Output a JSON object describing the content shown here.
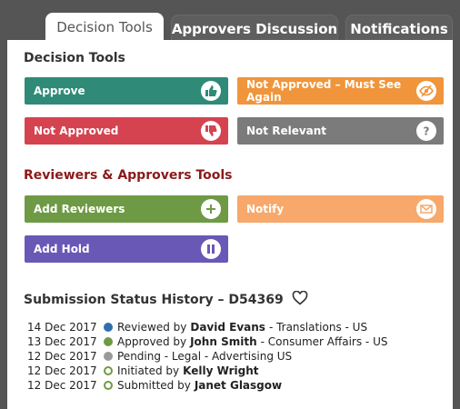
{
  "tabs": [
    {
      "label": "Decision Tools",
      "active": true
    },
    {
      "label": "Approvers Discussion",
      "active": false
    },
    {
      "label": "Notifications",
      "active": false
    }
  ],
  "decision_tools": {
    "title": "Decision Tools",
    "approve": "Approve",
    "not_approved_must_see_again": "Not Approved – Must See Again",
    "not_approved": "Not Approved",
    "not_relevant": "Not Relevant"
  },
  "reviewer_tools": {
    "title": "Reviewers & Approvers Tools",
    "add_reviewers": "Add Reviewers",
    "notify": "Notify",
    "add_hold": "Add Hold"
  },
  "history": {
    "title": "Submission Status History – D54369",
    "rows": [
      {
        "date": "14 Dec 2017",
        "action": "Reviewed by",
        "person": "David Evans",
        "detail": "- Translations - US",
        "dot_color": "#2f6fb0",
        "hollow": false
      },
      {
        "date": "13 Dec 2017",
        "action": "Approved by",
        "person": "John Smith",
        "detail": "- Consumer Affairs - US",
        "dot_color": "#6f9a45",
        "hollow": false
      },
      {
        "date": "12 Dec 2017",
        "action": "Pending - Legal - Advertising US",
        "person": "",
        "detail": "",
        "dot_color": "#9a9a9a",
        "hollow": false
      },
      {
        "date": "12 Dec 2017",
        "action": "Initiated by",
        "person": "Kelly Wright",
        "detail": "",
        "dot_color": "#6f9a45",
        "hollow": true
      },
      {
        "date": "12 Dec 2017",
        "action": "Submitted by",
        "person": "Janet Glasgow",
        "detail": "",
        "dot_color": "#6f9a45",
        "hollow": true
      }
    ]
  },
  "colors": {
    "section_title_dark": "#333333",
    "section_title_red": "#8b1a1a",
    "approve": "#2f8a78",
    "not_approved_must_see_again": "#f0953b",
    "not_approved": "#d4434f",
    "not_relevant": "#7b7b7b",
    "add_reviewers": "#6f9a45",
    "notify": "#f7a86a",
    "add_hold": "#6a58b6"
  },
  "icons": {
    "approve": "thumbs-up-icon",
    "not_approved_must_see_again": "eye-slash-icon",
    "not_approved": "thumbs-down-icon",
    "not_relevant": "question-icon",
    "add_reviewers": "plus-icon",
    "notify": "envelope-icon",
    "add_hold": "pause-icon",
    "favorite": "heart-outline-icon"
  }
}
